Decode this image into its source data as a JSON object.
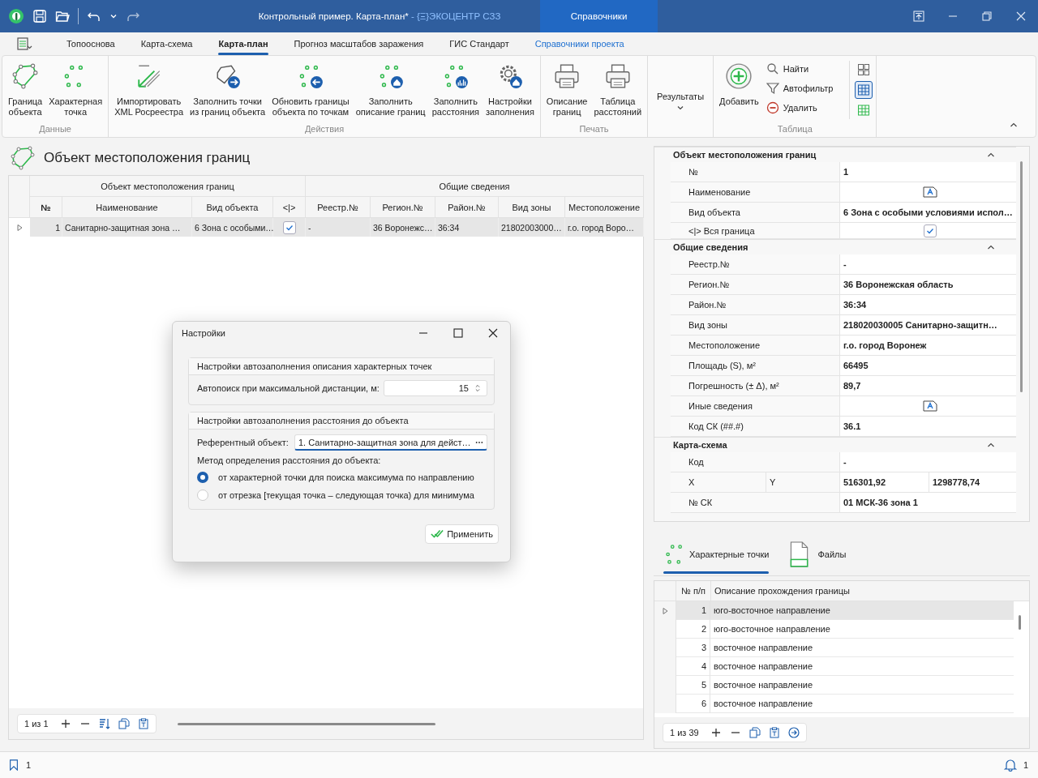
{
  "title_bar": {
    "title": "Контрольный пример. Карта-план*",
    "subtitle": " - {Ξ}ЭКОЦЕНТР СЗЗ",
    "context_tab": "Справочники"
  },
  "ribbon_tabs": [
    {
      "label": "Топооснова",
      "selected": false,
      "kind": "tab"
    },
    {
      "label": "Карта-схема",
      "selected": false,
      "kind": "tab"
    },
    {
      "label": "Карта-план",
      "selected": true,
      "kind": "tab"
    },
    {
      "label": "Прогноз масштабов заражения",
      "selected": false,
      "kind": "tab"
    },
    {
      "label": "ГИС Стандарт",
      "selected": false,
      "kind": "tab"
    },
    {
      "label": "Справочники проекта",
      "selected": false,
      "kind": "contextual"
    }
  ],
  "ribbon_groups": [
    {
      "label": "Данные",
      "buttons": [
        {
          "label": "Граница\nобъекта",
          "kind": "large"
        },
        {
          "label": "Характерная\nточка",
          "kind": "large"
        }
      ]
    },
    {
      "label": "Действия",
      "buttons": [
        {
          "label": "Импортировать\nXML Росреестра",
          "kind": "large"
        },
        {
          "label": "Заполнить точки\nиз границ объекта",
          "kind": "large"
        },
        {
          "label": "Обновить границы\nобъекта по точкам",
          "kind": "large"
        },
        {
          "label": "Заполнить\nописание границ",
          "kind": "large"
        },
        {
          "label": "Заполнить\nрасстояния",
          "kind": "large"
        },
        {
          "label": "Настройки\nзаполнения",
          "kind": "large"
        }
      ]
    },
    {
      "label": "Печать",
      "buttons": [
        {
          "label": "Описание\nграниц",
          "kind": "large"
        },
        {
          "label": "Таблица\nрасстояний",
          "kind": "large"
        }
      ]
    },
    {
      "buttons": [
        {
          "label": "Результаты",
          "kind": "dropdown"
        }
      ]
    },
    {
      "label": "Таблица",
      "buttons": [
        {
          "label": "Добавить",
          "kind": "large"
        },
        {
          "label": "Найти",
          "kind": "small"
        },
        {
          "label": "Автофильтр",
          "kind": "small"
        },
        {
          "label": "Удалить",
          "kind": "small"
        }
      ],
      "view_toggles": [
        {
          "selected": false
        },
        {
          "selected": true
        },
        {
          "selected": false
        }
      ]
    }
  ],
  "main_panel": {
    "title": "Объект местоположения границ",
    "bands": [
      {
        "label": "Объект местоположения границ",
        "columns": [
          "№",
          "Наименование",
          "Вид объекта",
          "<|>"
        ]
      },
      {
        "label": "Общие сведения",
        "columns": [
          "Реестр.№",
          "Регион.№",
          "Район.№",
          "Вид зоны",
          "Местоположение"
        ]
      }
    ],
    "rows": [
      {
        "selected": true,
        "number": "1",
        "name": "Санитарно-защитная зона …",
        "object_type": "6 Зона с особыми…",
        "whole_boundary": true,
        "registry": "-",
        "region": "36 Воронежс…",
        "district": "36:34",
        "zone_type": "21802003000…",
        "location": "г.о. город Воро…"
      }
    ],
    "pager": "1 из 1"
  },
  "properties": {
    "sections": [
      {
        "title": "Объект местоположения границ",
        "expanded": true,
        "rows": [
          {
            "kind": "text",
            "label": "№",
            "value": "1"
          },
          {
            "kind": "memo",
            "label": "Наименование"
          },
          {
            "kind": "text",
            "label": "Вид объекта",
            "value": "6 Зона с особыми условиями испол…"
          },
          {
            "kind": "check",
            "label": "<|> Вся граница",
            "checked": true
          }
        ]
      },
      {
        "title": "Общие сведения",
        "expanded": true,
        "rows": [
          {
            "kind": "text",
            "label": "Реестр.№",
            "value": "-"
          },
          {
            "kind": "text",
            "label": "Регион.№",
            "value": "36 Воронежская область"
          },
          {
            "kind": "text",
            "label": "Район.№",
            "value": "36:34"
          },
          {
            "kind": "text",
            "label": "Вид зоны",
            "value": "218020030005 Санитарно-защитн…"
          },
          {
            "kind": "text",
            "label": "Местоположение",
            "value": "г.о. город Воронеж"
          },
          {
            "kind": "text",
            "label": "Площадь (S), м²",
            "value": "66495"
          },
          {
            "kind": "text",
            "label": "Погрешность (± Δ), м²",
            "value": "89,7"
          },
          {
            "kind": "memo",
            "label": "Иные сведения"
          },
          {
            "kind": "text",
            "label": "Код СК (##.#)",
            "value": "36.1"
          }
        ]
      },
      {
        "title": "Карта-схема",
        "expanded": true,
        "rows": [
          {
            "kind": "text",
            "label": "Код",
            "value": "-"
          },
          {
            "kind": "pair",
            "labels": [
              "X",
              "Y"
            ],
            "values": [
              "516301,92",
              "1298778,74"
            ]
          },
          {
            "kind": "text",
            "label": "№ СК",
            "value": "01 МСК-36 зона 1"
          }
        ]
      }
    ]
  },
  "detail_tabs": [
    {
      "label": "Характерные точки",
      "selected": true
    },
    {
      "label": "Файлы",
      "selected": false
    }
  ],
  "points_table": {
    "columns": [
      "№ п/п",
      "Описание прохождения границы"
    ],
    "rows": [
      {
        "number": "1",
        "description": "юго-восточное направление",
        "selected": true
      },
      {
        "number": "2",
        "description": "юго-восточное направление",
        "selected": false
      },
      {
        "number": "3",
        "description": "восточное направление",
        "selected": false
      },
      {
        "number": "4",
        "description": "восточное направление",
        "selected": false
      },
      {
        "number": "5",
        "description": "восточное направление",
        "selected": false
      },
      {
        "number": "6",
        "description": "восточное направление",
        "selected": false
      }
    ],
    "pager": "1 из 39"
  },
  "status_bar": {
    "bookmarks": "1",
    "notifications": "1"
  },
  "dialog": {
    "title": "Настройки",
    "points_group": {
      "title": "Настройки автозаполнения описания характерных точек",
      "distance_label": "Автопоиск при максимальной дистанции, м:",
      "distance_value": "15"
    },
    "distance_group": {
      "title": "Настройки автозаполнения расстояния до объекта",
      "reference_label": "Референтный объект:",
      "reference_value": "1. Санитарно-защитная зона для дейст…",
      "method_label": "Метод определения расстояния до объекта:",
      "methods": [
        {
          "label": "от характерной точки для поиска максимума по направлению",
          "selected": true
        },
        {
          "label": "от отрезка [текущая точка – следующая точка) для минимума",
          "selected": false
        }
      ]
    },
    "apply_button": "Применить"
  }
}
